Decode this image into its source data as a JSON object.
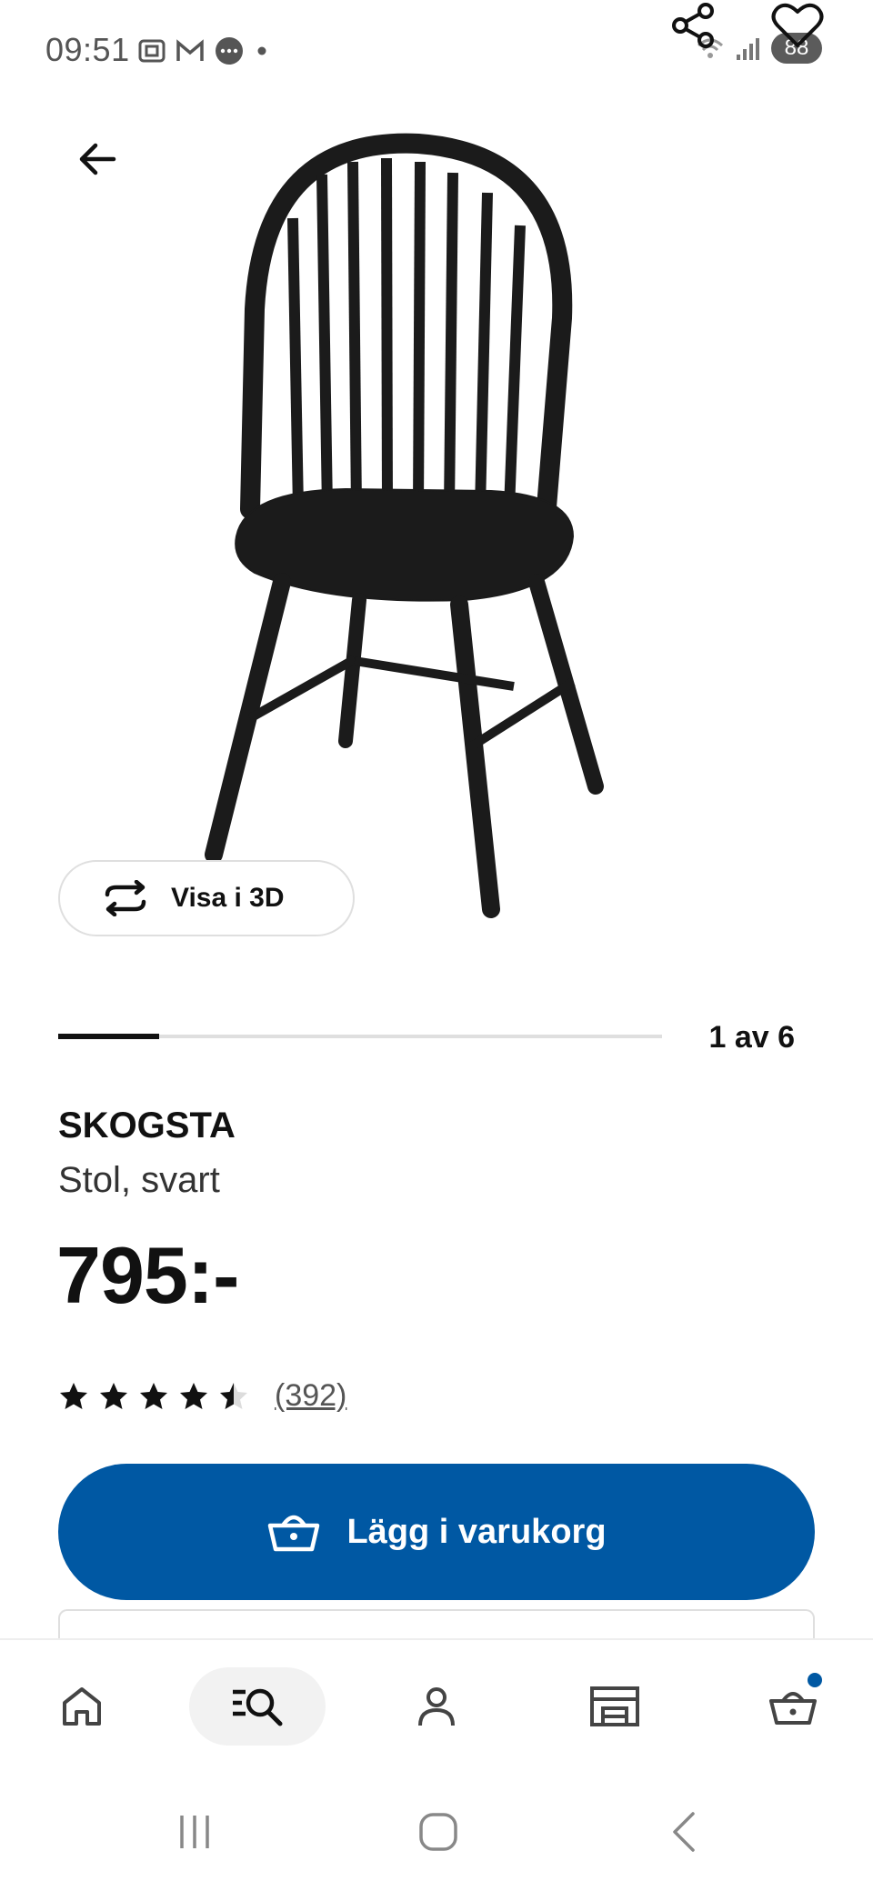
{
  "status_bar": {
    "time": "09:51",
    "battery": "88"
  },
  "gallery": {
    "view_3d_label": "Visa i 3D",
    "position": "1 av 6",
    "progress_fraction": 0.1667
  },
  "product": {
    "name": "SKOGSTA",
    "description": "Stol, svart",
    "price": "795:-",
    "rating": 4.5,
    "reviews": "(392)"
  },
  "actions": {
    "add_to_cart_label": "Lägg i varukorg"
  },
  "colors": {
    "brand_blue": "#0058a3",
    "text": "#111111"
  },
  "icons": {
    "back": "arrow-left-icon",
    "share": "share-icon",
    "favorite": "heart-icon",
    "view3d": "rotate-icon",
    "cart": "basket-icon",
    "nav_home": "home-icon",
    "nav_search": "search-icon",
    "nav_profile": "person-icon",
    "nav_stores": "store-icon",
    "nav_cart": "basket-icon"
  }
}
